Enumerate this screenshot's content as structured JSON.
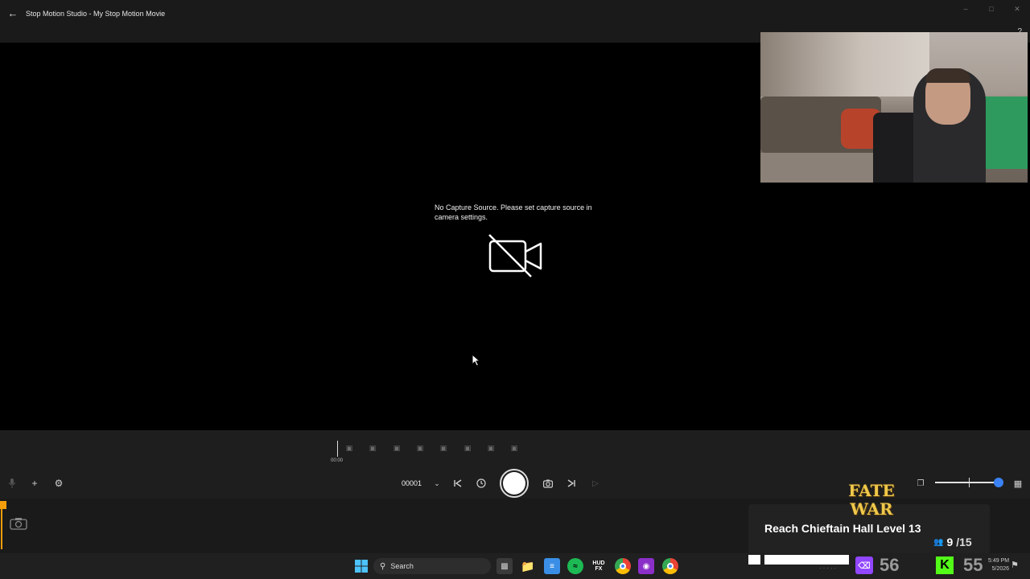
{
  "window": {
    "title": "Stop Motion Studio - My Stop Motion Movie"
  },
  "stage": {
    "message": "No Capture Source. Please set capture source in camera settings."
  },
  "timeline": {
    "time": "00:00"
  },
  "controls": {
    "frame_number": "00001"
  },
  "stream_overlay": {
    "logo_line1": "FATE",
    "logo_line2": "WAR",
    "goal_text": "Reach Chieftain Hall Level 13",
    "goal_current": "9",
    "goal_total": "/15",
    "stat_twitch": "56",
    "stat_kick": "55"
  },
  "taskbar": {
    "search_label": "Search",
    "hud_label": "HUD FX",
    "time": "5:49 PM",
    "date": "5/2026"
  },
  "colors": {
    "accent_blue": "#3b82f6",
    "frame_marker": "#f59e0b",
    "twitch": "#9146ff",
    "kick": "#53fc18"
  }
}
